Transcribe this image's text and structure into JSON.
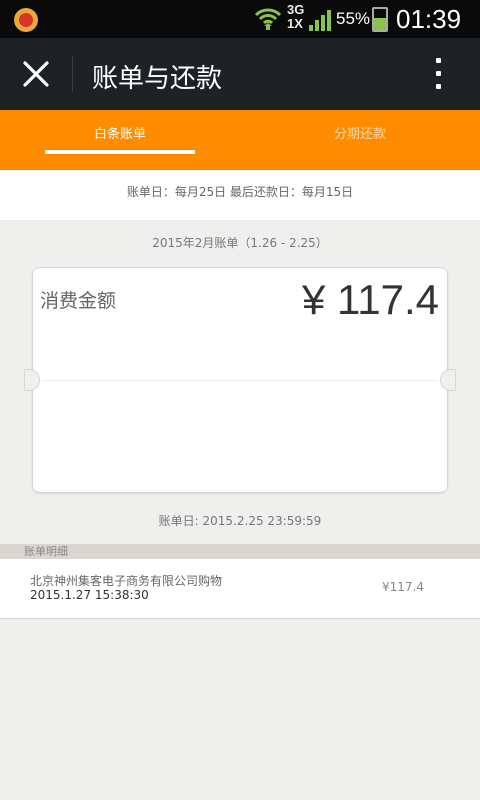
{
  "status_bar": {
    "network": "3G",
    "network_sub": "1X",
    "battery_percent": "55%",
    "battery_level": 0.55,
    "time": "01:39"
  },
  "titlebar": {
    "title": "账单与还款",
    "close_icon": "close-icon",
    "more_icon": "more-vertical-icon"
  },
  "tabs": [
    {
      "label": "白条账单",
      "active": true
    },
    {
      "label": "分期还款",
      "active": false
    }
  ],
  "billing_cycle": "账单日：每月25日 最后还款日：每月15日",
  "statement": {
    "period": "2015年2月账单（1.26 - 2.25）",
    "amount_label": "消费金额",
    "amount": "¥ 117.4",
    "bill_date": "账单日: 2015.2.25 23:59:59"
  },
  "details": {
    "header": "账单明细",
    "items": [
      {
        "merchant": "北京神州集客电子商务有限公司购物",
        "time": "2015.1.27 15:38:30",
        "amount": "¥117.4"
      }
    ]
  },
  "colors": {
    "accent": "#ff8c00",
    "titlebar": "#1f2225",
    "background": "#efefed"
  }
}
